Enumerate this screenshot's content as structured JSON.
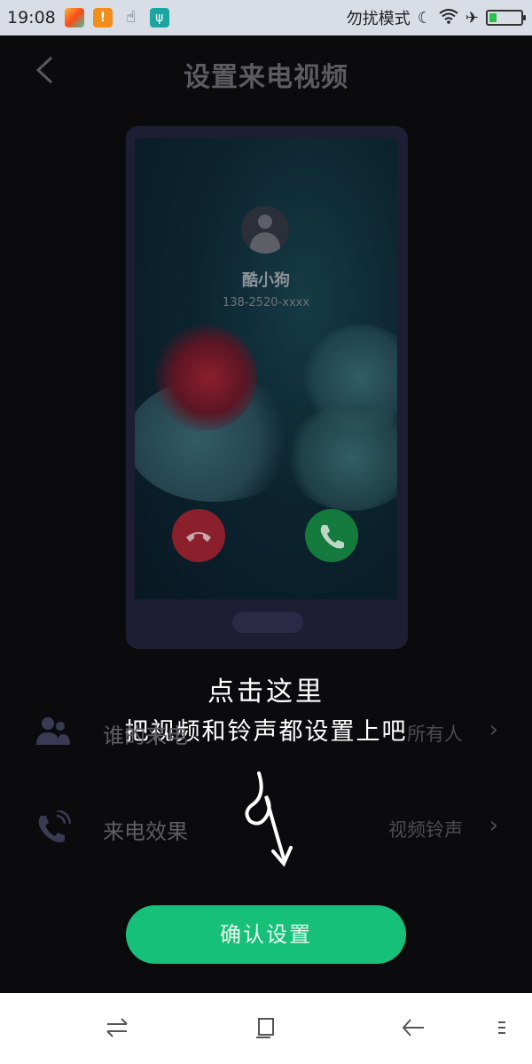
{
  "status_bar": {
    "time": "19:08",
    "dnd_label": "勿扰模式",
    "icons": [
      "photos-icon",
      "warning-icon",
      "touch-icon",
      "usb-icon",
      "moon-icon",
      "wifi-icon",
      "airplane-icon",
      "battery-icon"
    ]
  },
  "header": {
    "title": "设置来电视频",
    "back_icon": "chevron-left-icon"
  },
  "preview": {
    "caller_name": "酷小狗",
    "caller_number": "138-2520-xxxx",
    "decline_icon": "hang-up-icon",
    "accept_icon": "phone-icon"
  },
  "guide": {
    "line1": "点击这里",
    "line2": "把视频和铃声都设置上吧"
  },
  "settings": [
    {
      "label": "谁的来电",
      "value": "所有人",
      "icon": "contacts-icon"
    },
    {
      "label": "来电效果",
      "value": "视频铃声",
      "icon": "ringing-phone-icon"
    }
  ],
  "confirm_button": {
    "label": "确认设置"
  },
  "navbar": {
    "items": [
      "switch-apps-icon",
      "home-square-icon",
      "back-arrow-icon",
      "menu-icon"
    ]
  },
  "colors": {
    "accent": "#16c078",
    "background": "#0b0b0d",
    "status_bar": "#d8dde6"
  }
}
